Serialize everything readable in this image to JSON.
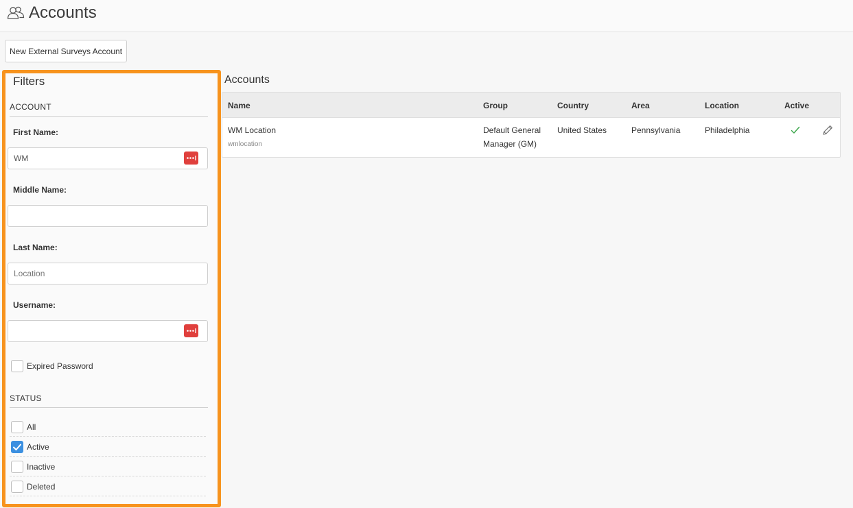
{
  "header": {
    "title": "Accounts",
    "icon": "users-icon"
  },
  "toolbar": {
    "new_button_label": "New External Surveys Account"
  },
  "filters": {
    "title": "Filters",
    "account_section": "ACCOUNT",
    "first_name": {
      "label": "First Name:",
      "value": "WM"
    },
    "middle_name": {
      "label": "Middle Name:",
      "value": ""
    },
    "last_name": {
      "label": "Last Name:",
      "placeholder": "Location"
    },
    "username": {
      "label": "Username:",
      "value": ""
    },
    "expired_password": {
      "label": "Expired Password",
      "checked": false
    },
    "status_section": "STATUS",
    "status_options": [
      {
        "label": "All",
        "checked": false
      },
      {
        "label": "Active",
        "checked": true
      },
      {
        "label": "Inactive",
        "checked": false
      },
      {
        "label": "Deleted",
        "checked": false
      }
    ],
    "accent_color": "#f7931e"
  },
  "accounts": {
    "title": "Accounts",
    "columns": [
      "Name",
      "Group",
      "Country",
      "Area",
      "Location",
      "Active"
    ],
    "rows": [
      {
        "name": "WM Location",
        "username": "wmlocation",
        "group_line1": "Default General",
        "group_line2": "Manager (GM)",
        "country": "United States",
        "area": "Pennsylvania",
        "location": "Philadelphia",
        "active": true,
        "active_icon": "checkmark-icon",
        "edit_icon": "pencil-icon"
      }
    ]
  },
  "colors": {
    "checkbox_checked": "#3b8fe0",
    "password_manager_icon": "#e0403d",
    "active_check": "#3aa64a"
  }
}
